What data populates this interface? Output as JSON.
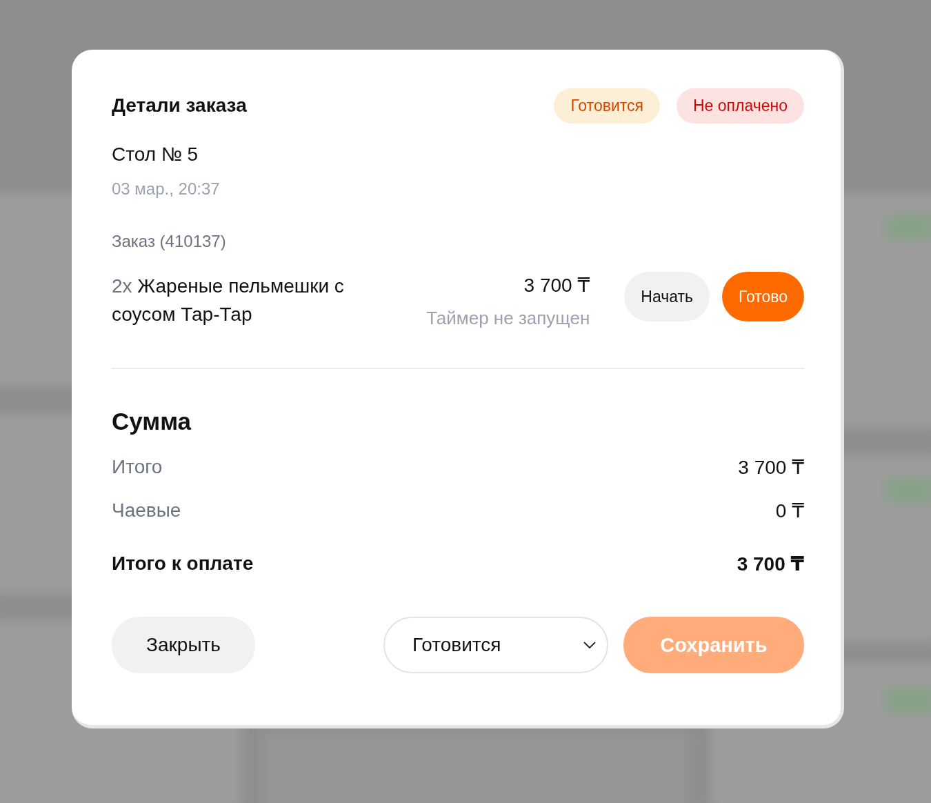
{
  "modal": {
    "title": "Детали заказа",
    "badges": [
      {
        "label": "Готовится",
        "kind": "warning"
      },
      {
        "label": "Не оплачено",
        "kind": "danger"
      }
    ],
    "table": "Стол № 5",
    "datetime": "03 мар., 20:37",
    "order_label": "Заказ (410137)",
    "items": [
      {
        "quantity": "2x",
        "name": "Жареные пельмешки с соусом Тар-Тар",
        "price": "3 700 ₸",
        "timer": "Таймер не запущен",
        "start_button": "Начать",
        "done_button": "Готово"
      }
    ],
    "summary": {
      "title": "Сумма",
      "rows": [
        {
          "label": "Итого",
          "value": "3 700 ₸",
          "kind": "normal"
        },
        {
          "label": "Чаевые",
          "value": "0 ₸",
          "kind": "normal"
        },
        {
          "label": "Итого к оплате",
          "value": "3 700 ₸",
          "kind": "total"
        }
      ]
    },
    "close_button": "Закрыть",
    "status_select": {
      "value": "Готовится"
    },
    "save_button": {
      "label": "Сохранить",
      "disabled": true
    }
  }
}
